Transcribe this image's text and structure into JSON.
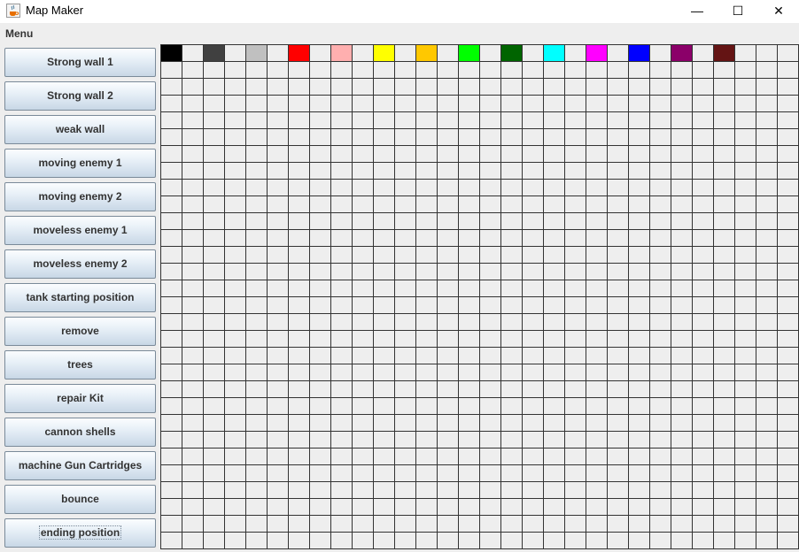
{
  "window": {
    "title": "Map Maker",
    "icon": "java-cup-icon",
    "controls": {
      "minimize": "—",
      "maximize": "☐",
      "close": "✕"
    }
  },
  "menubar": {
    "menu_label": "Menu"
  },
  "toolbox": {
    "buttons": [
      "Strong wall 1",
      "Strong wall 2",
      "weak wall",
      "moving enemy 1",
      "moving enemy 2",
      "moveless enemy 1",
      "moveless enemy 2",
      "tank starting position",
      "remove",
      "trees",
      "repair Kit",
      "cannon shells",
      "machine Gun Cartridges",
      "bounce",
      "ending position"
    ],
    "focused_index": 14
  },
  "palette_colors": [
    "#000000",
    null,
    "#404040",
    null,
    "#c0c0c0",
    null,
    "#ff0000",
    null,
    "#ffafaf",
    null,
    "#ffff00",
    null,
    "#ffc800",
    null,
    "#00ff00",
    null,
    "#006400",
    null,
    "#00ffff",
    null,
    "#ff00ff",
    null,
    "#0000ff",
    null,
    "#8b0069",
    null,
    "#641414",
    null,
    null,
    null
  ],
  "grid": {
    "columns": 30,
    "rows": 30
  }
}
